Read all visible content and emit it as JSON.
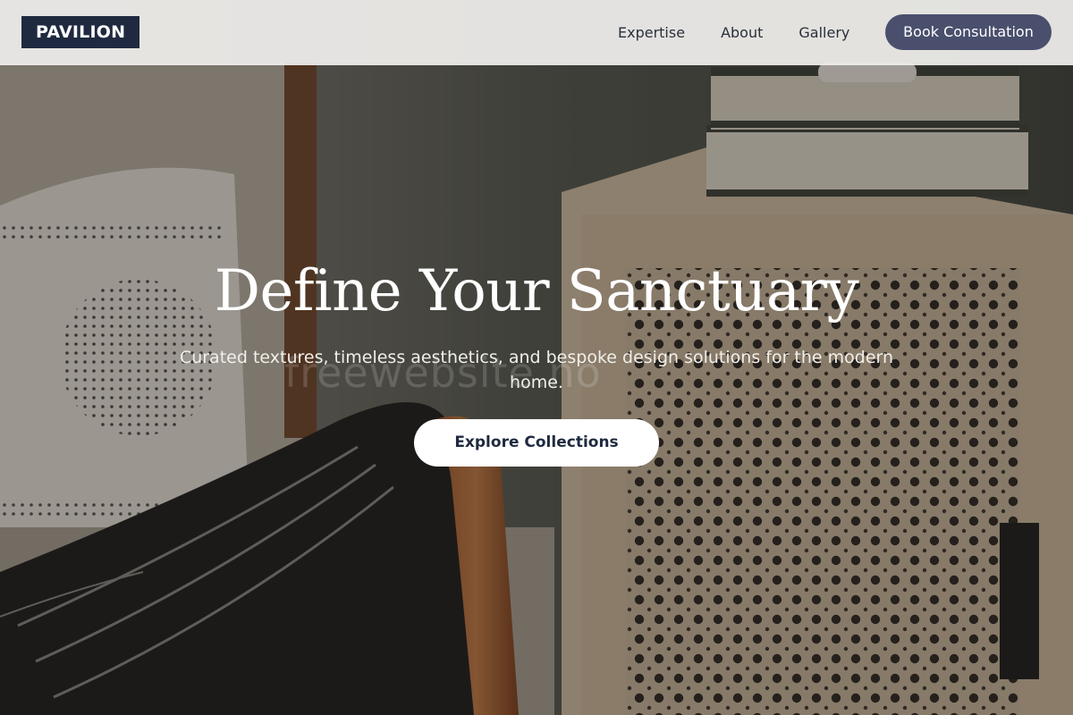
{
  "header": {
    "logo": "PAVILION",
    "nav": [
      {
        "label": "Expertise"
      },
      {
        "label": "About"
      },
      {
        "label": "Gallery"
      }
    ],
    "cta_label": "Book Consultation"
  },
  "hero": {
    "title": "Define Your Sanctuary",
    "subtitle": "Curated textures, timeless aesthetics, and bespoke design solutions for the modern home.",
    "button_label": "Explore Collections",
    "watermark": "freewebsite.no"
  },
  "colors": {
    "logo_bg": "#1f2a40",
    "cta_bg": "#4a4f6d",
    "header_bg": "#f0efed",
    "explore_text": "#1f2a40"
  },
  "icons": []
}
